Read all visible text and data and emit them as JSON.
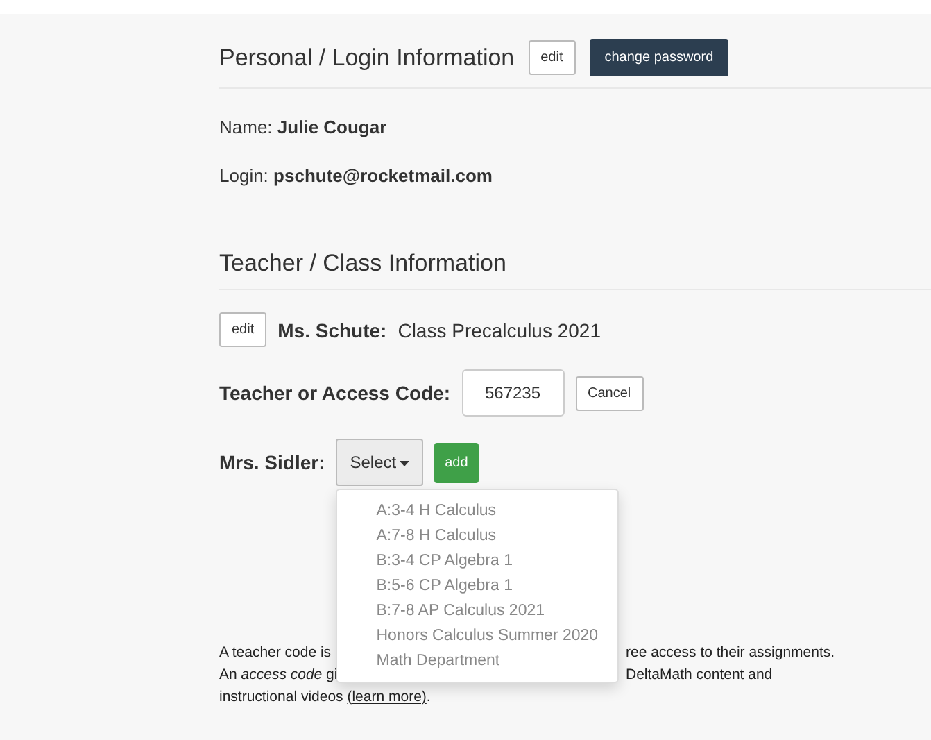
{
  "personal": {
    "title": "Personal / Login Information",
    "edit_button": "edit",
    "change_password_button": "change password",
    "fields": [
      {
        "label": "Name:",
        "value": "Julie Cougar"
      },
      {
        "label": "Login:",
        "value": "pschute@rocketmail.com"
      }
    ]
  },
  "teacher": {
    "title": "Teacher / Class Information",
    "edit_button": "edit",
    "teacher_name": "Ms. Schute:",
    "class_name": "Class Precalculus 2021",
    "code_label": "Teacher or Access Code:",
    "code_value": "567235",
    "cancel_button": "Cancel",
    "select_label": "Mrs. Sidler:",
    "select_button": "Select",
    "add_button": "add",
    "dropdown": {
      "expanded": true,
      "items": [
        "A:3-4 H Calculus",
        "A:7-8 H Calculus",
        "B:3-4 CP Algebra 1",
        "B:5-6 CP Algebra 1",
        "B:7-8 AP Calculus 2021",
        "Honors Calculus Summer 2020",
        "Math Department"
      ]
    }
  },
  "note": {
    "lines": [
      {
        "left": "A teacher code is",
        "right": "ree access to their assignments."
      },
      {
        "left": "An *access code* gi",
        "right": "DeltaMath content and"
      }
    ],
    "last_line": "instructional videos",
    "link": "(learn more)",
    "end": "."
  }
}
